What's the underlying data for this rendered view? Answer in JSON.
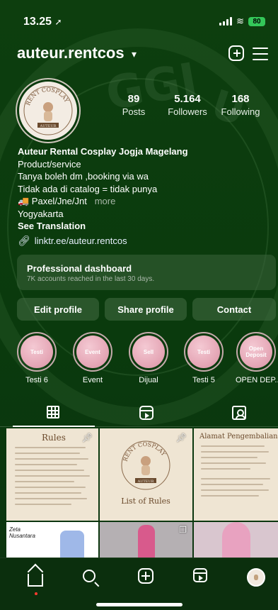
{
  "status_bar": {
    "time": "13.25",
    "location_icon": "location-arrow-icon",
    "battery": "80"
  },
  "header": {
    "username": "auteur.rentcos",
    "chevron": "⌄",
    "new_post_icon": "plus-square-icon",
    "menu_icon": "hamburger-menu-icon"
  },
  "profile": {
    "avatar_text_top": "RENT COSPLAY",
    "avatar_text_bottom": "AUTEUR",
    "stats": [
      {
        "value": "89",
        "label": "Posts"
      },
      {
        "value": "5.164",
        "label": "Followers"
      },
      {
        "value": "168",
        "label": "Following"
      }
    ],
    "name": "Auteur Rental Cosplay Jogja Magelang",
    "category": "Product/service",
    "bio_lines": [
      "Tanya boleh dm ,booking via wa",
      "Tidak ada di catalog = tidak punya",
      "🚚 Paxel/Jne/Jnt"
    ],
    "more": "more",
    "location": "Yogyakarta",
    "see_translation": "See Translation",
    "link": "linktr.ee/auteur.rentcos"
  },
  "dashboard": {
    "title": "Professional dashboard",
    "subtitle": "7K accounts reached in the last 30 days."
  },
  "buttons": {
    "edit": "Edit profile",
    "share": "Share profile",
    "contact": "Contact"
  },
  "highlights": [
    {
      "cover": "Testi",
      "label": "Testi 6"
    },
    {
      "cover": "Event",
      "label": "Event"
    },
    {
      "cover": "Sell",
      "label": "Dijual"
    },
    {
      "cover": "Testi",
      "label": "Testi 5"
    },
    {
      "cover": "Open Deposit",
      "label": "OPEN DEP..."
    }
  ],
  "tabs": [
    "grid-icon",
    "reels-icon",
    "tagged-icon"
  ],
  "posts": {
    "rules_title": "Rules",
    "list_title": "List of Rules",
    "logo_top": "RENT COSPLAY",
    "logo_bottom": "AUTEUR",
    "address_title": "Alamat Pengembalian",
    "brand_text": "Zeta Nusantara"
  },
  "bottom_nav": [
    "home-icon",
    "search-icon",
    "create-icon",
    "reels-icon",
    "profile-icon"
  ]
}
